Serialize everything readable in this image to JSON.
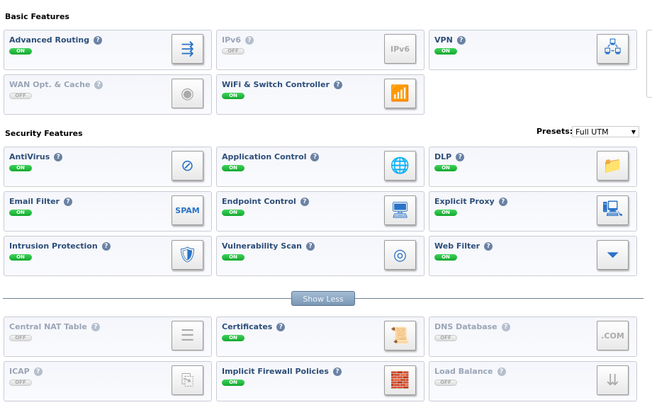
{
  "basic": {
    "title": "Basic Features",
    "items": [
      {
        "name": "Advanced Routing",
        "state": "ON",
        "icon": "routing-icon",
        "glyph": "⇶"
      },
      {
        "name": "IPv6",
        "state": "OFF",
        "icon": "ipv6-icon",
        "glyph": "IPv6"
      },
      {
        "name": "VPN",
        "state": "ON",
        "icon": "vpn-network-icon",
        "glyph": "🖧"
      },
      {
        "name": "WAN Opt. & Cache",
        "state": "OFF",
        "icon": "wan-cache-icon",
        "glyph": "◉"
      },
      {
        "name": "WiFi & Switch Controller",
        "state": "ON",
        "icon": "wifi-switch-icon",
        "glyph": "📶"
      }
    ]
  },
  "security": {
    "title": "Security Features",
    "presets_label": "Presets:",
    "preset_value": "Full UTM",
    "items": [
      {
        "name": "AntiVirus",
        "state": "ON",
        "icon": "antivirus-icon",
        "glyph": "⊘"
      },
      {
        "name": "Application Control",
        "state": "ON",
        "icon": "application-control-icon",
        "glyph": "🌐"
      },
      {
        "name": "DLP",
        "state": "ON",
        "icon": "dlp-folder-icon",
        "glyph": "📁"
      },
      {
        "name": "Email Filter",
        "state": "ON",
        "icon": "spam-filter-icon",
        "glyph": "SPAM"
      },
      {
        "name": "Endpoint Control",
        "state": "ON",
        "icon": "endpoint-icon",
        "glyph": "🖥"
      },
      {
        "name": "Explicit Proxy",
        "state": "ON",
        "icon": "proxy-icon",
        "glyph": "🖳"
      },
      {
        "name": "Intrusion Protection",
        "state": "ON",
        "icon": "shield-icon",
        "glyph": "🛡"
      },
      {
        "name": "Vulnerability Scan",
        "state": "ON",
        "icon": "radar-icon",
        "glyph": "◎"
      },
      {
        "name": "Web Filter",
        "state": "ON",
        "icon": "web-filter-icon",
        "glyph": "⏷"
      }
    ]
  },
  "toggle_label": "Show Less",
  "more": {
    "items": [
      {
        "name": "Central NAT Table",
        "state": "OFF",
        "icon": "nat-table-icon",
        "glyph": "☰"
      },
      {
        "name": "Certificates",
        "state": "ON",
        "icon": "certificate-icon",
        "glyph": "📜"
      },
      {
        "name": "DNS Database",
        "state": "OFF",
        "icon": "dns-icon",
        "glyph": ".COM"
      },
      {
        "name": "ICAP",
        "state": "OFF",
        "icon": "icap-icon",
        "glyph": "⎘"
      },
      {
        "name": "Implicit Firewall Policies",
        "state": "ON",
        "icon": "firewall-icon",
        "glyph": "🧱"
      },
      {
        "name": "Load Balance",
        "state": "OFF",
        "icon": "load-balance-icon",
        "glyph": "⇊"
      }
    ]
  }
}
